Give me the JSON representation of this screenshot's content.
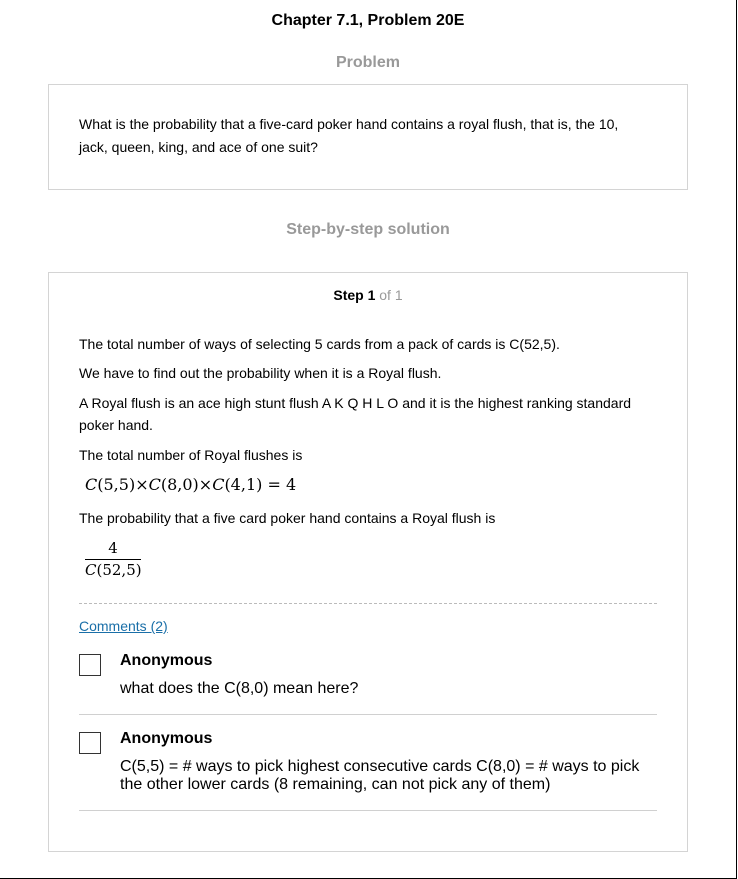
{
  "header": {
    "title": "Chapter 7.1, Problem 20E"
  },
  "problem": {
    "heading": "Problem",
    "text": "What is the probability that a five-card poker hand contains a royal flush, that is, the 10, jack, queen, king, and ace of one suit?"
  },
  "solution": {
    "heading": "Step-by-step solution",
    "step_word": "Step 1",
    "step_of": "of 1",
    "paragraphs": [
      "The total number of ways of selecting 5 cards from a pack of cards is C(52,5).",
      "We have to find out the probability when it is a Royal flush.",
      "A Royal flush is an ace high stunt flush A K Q H L O and it is the highest ranking standard poker hand.",
      "The total number of Royal flushes is",
      "The probability that a five card poker hand contains a Royal flush is"
    ],
    "formula": {
      "c1": "C",
      "a1": "(5,5)",
      "x1": "×",
      "c2": "C",
      "a2": "(8,0)",
      "x2": "×",
      "c3": "C",
      "a3": "(4,1)",
      "eq": " = 4"
    },
    "fraction": {
      "numerator": "4",
      "den_c": "C",
      "den_args": "(52,5)"
    }
  },
  "comments": {
    "link_label": "Comments (2)",
    "items": [
      {
        "author": "Anonymous",
        "text": "what does the C(8,0) mean here?"
      },
      {
        "author": "Anonymous",
        "text": "C(5,5) = # ways to pick highest consecutive cards C(8,0) = # ways to pick the other lower cards (8 remaining, can not pick any of them)"
      }
    ]
  }
}
